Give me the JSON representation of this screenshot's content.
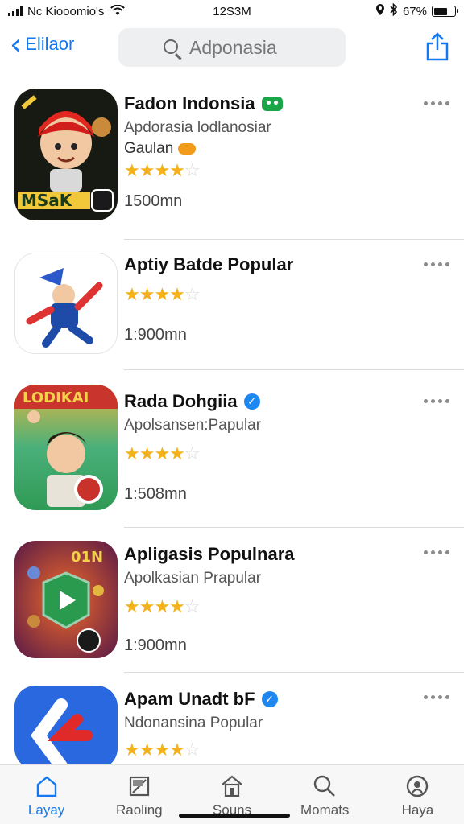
{
  "status": {
    "carrier": "Nc Kiooomio's",
    "time": "12S3M",
    "battery": "67%",
    "battery_level": 0.67
  },
  "nav": {
    "back_label": "Elilaor",
    "search_placeholder": "Adponasia"
  },
  "apps": [
    {
      "title": "Fadon Indonsia",
      "subtitle": "Apdorasia lodlanosiar",
      "genre": "Gaulan",
      "size": "1500mn",
      "rating": 4.5
    },
    {
      "title": "Aptiy Batde Popular",
      "subtitle": "",
      "genre": "",
      "size": "1:900mn",
      "rating": 4.5
    },
    {
      "title": "Rada Dohgiia",
      "subtitle": "Apolsansen:Papular",
      "genre": "",
      "size": "1:508mn",
      "rating": 4.5
    },
    {
      "title": "Apligasis Populnara",
      "subtitle": "Apolkasian Prapular",
      "genre": "",
      "size": "1:900mn",
      "rating": 4.5
    },
    {
      "title": "Apam Unadt bF",
      "subtitle": "Ndonansina Popular",
      "genre": "",
      "size": "",
      "rating": 4.5
    }
  ],
  "icons": {
    "icon_1_text": "MSaK",
    "icon_3_text": "LODIKAI",
    "icon_4_text": "01N"
  },
  "tabs": [
    {
      "label": "Layay",
      "icon": "home-icon"
    },
    {
      "label": "Raoling",
      "icon": "flag-icon"
    },
    {
      "label": "Souns",
      "icon": "house-icon"
    },
    {
      "label": "Momats",
      "icon": "search-icon"
    },
    {
      "label": "Haya",
      "icon": "profile-icon"
    }
  ],
  "colors": {
    "accent": "#1479f0",
    "star": "#f3b21c"
  }
}
